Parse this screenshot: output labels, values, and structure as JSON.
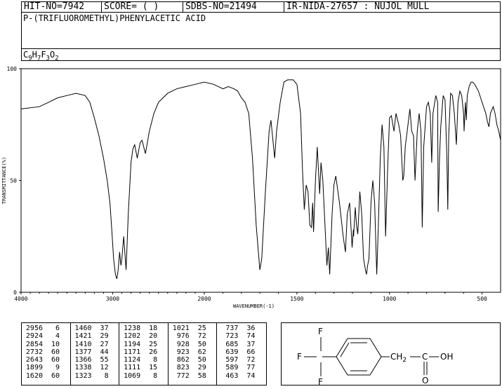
{
  "header": {
    "hit_no": "HIT-NO=7942",
    "score": "SCORE=  (   )",
    "sdbs_no": "SDBS-NO=21494",
    "ir_info": "IR-NIDA-27657 : NUJOL MULL"
  },
  "compound_name": "P-(TRIFLUOROMETHYL)PHENYLACETIC ACID",
  "formula": {
    "c": "C",
    "c_n": "9",
    "h": "H",
    "h_n": "7",
    "f": "F",
    "f_n": "3",
    "o": "O",
    "o_n": "2"
  },
  "chart_data": {
    "type": "line",
    "title": "",
    "xlabel": "WAVENUMBER(-1)",
    "ylabel": "TRANSMITTANCE(%)",
    "xlim": [
      4000,
      400
    ],
    "ylim": [
      0,
      100
    ],
    "x_ticks": [
      "4000",
      "3000",
      "2000",
      "1500",
      "1000",
      "500"
    ],
    "y_ticks": [
      "100",
      "50",
      "0"
    ],
    "grid": false,
    "series": [
      {
        "points": [
          [
            4000,
            82
          ],
          [
            3800,
            83
          ],
          [
            3700,
            85
          ],
          [
            3600,
            87
          ],
          [
            3500,
            88
          ],
          [
            3400,
            89
          ],
          [
            3300,
            88
          ],
          [
            3250,
            85
          ],
          [
            3200,
            78
          ],
          [
            3150,
            70
          ],
          [
            3100,
            60
          ],
          [
            3060,
            50
          ],
          [
            3030,
            40
          ],
          [
            3010,
            28
          ],
          [
            2990,
            15
          ],
          [
            2970,
            8
          ],
          [
            2955,
            6
          ],
          [
            2940,
            10
          ],
          [
            2924,
            18
          ],
          [
            2910,
            12
          ],
          [
            2900,
            15
          ],
          [
            2880,
            25
          ],
          [
            2854,
            10
          ],
          [
            2830,
            35
          ],
          [
            2800,
            58
          ],
          [
            2780,
            64
          ],
          [
            2760,
            66
          ],
          [
            2732,
            60
          ],
          [
            2700,
            67
          ],
          [
            2680,
            68
          ],
          [
            2643,
            62
          ],
          [
            2600,
            72
          ],
          [
            2550,
            80
          ],
          [
            2500,
            85
          ],
          [
            2400,
            89
          ],
          [
            2300,
            91
          ],
          [
            2200,
            92
          ],
          [
            2100,
            93
          ],
          [
            2000,
            94
          ],
          [
            1950,
            93
          ],
          [
            1899,
            91
          ],
          [
            1870,
            92
          ],
          [
            1840,
            91
          ],
          [
            1820,
            90
          ],
          [
            1800,
            87
          ],
          [
            1780,
            85
          ],
          [
            1760,
            80
          ],
          [
            1740,
            60
          ],
          [
            1720,
            30
          ],
          [
            1705,
            15
          ],
          [
            1700,
            10
          ],
          [
            1690,
            15
          ],
          [
            1670,
            45
          ],
          [
            1650,
            72
          ],
          [
            1640,
            77
          ],
          [
            1620,
            60
          ],
          [
            1610,
            72
          ],
          [
            1590,
            85
          ],
          [
            1570,
            94
          ],
          [
            1550,
            95
          ],
          [
            1520,
            95
          ],
          [
            1500,
            93
          ],
          [
            1480,
            80
          ],
          [
            1470,
            55
          ],
          [
            1460,
            37
          ],
          [
            1450,
            48
          ],
          [
            1440,
            45
          ],
          [
            1430,
            30
          ],
          [
            1421,
            29
          ],
          [
            1415,
            40
          ],
          [
            1410,
            27
          ],
          [
            1400,
            50
          ],
          [
            1390,
            65
          ],
          [
            1385,
            57
          ],
          [
            1377,
            44
          ],
          [
            1370,
            58
          ],
          [
            1366,
            55
          ],
          [
            1360,
            50
          ],
          [
            1338,
            12
          ],
          [
            1330,
            20
          ],
          [
            1323,
            8
          ],
          [
            1310,
            35
          ],
          [
            1300,
            48
          ],
          [
            1290,
            52
          ],
          [
            1270,
            40
          ],
          [
            1250,
            25
          ],
          [
            1238,
            18
          ],
          [
            1228,
            35
          ],
          [
            1215,
            40
          ],
          [
            1202,
            20
          ],
          [
            1195,
            28
          ],
          [
            1194,
            25
          ],
          [
            1185,
            38
          ],
          [
            1178,
            30
          ],
          [
            1171,
            26
          ],
          [
            1160,
            45
          ],
          [
            1150,
            35
          ],
          [
            1140,
            15
          ],
          [
            1130,
            10
          ],
          [
            1124,
            8
          ],
          [
            1118,
            12
          ],
          [
            1111,
            15
          ],
          [
            1100,
            40
          ],
          [
            1090,
            50
          ],
          [
            1080,
            40
          ],
          [
            1069,
            8
          ],
          [
            1060,
            30
          ],
          [
            1050,
            60
          ],
          [
            1040,
            75
          ],
          [
            1030,
            65
          ],
          [
            1021,
            25
          ],
          [
            1010,
            55
          ],
          [
            1000,
            78
          ],
          [
            990,
            79
          ],
          [
            976,
            72
          ],
          [
            965,
            80
          ],
          [
            950,
            75
          ],
          [
            940,
            70
          ],
          [
            928,
            50
          ],
          [
            923,
            52
          ],
          [
            915,
            65
          ],
          [
            900,
            75
          ],
          [
            890,
            82
          ],
          [
            880,
            72
          ],
          [
            870,
            70
          ],
          [
            862,
            50
          ],
          [
            850,
            72
          ],
          [
            840,
            80
          ],
          [
            830,
            72
          ],
          [
            823,
            29
          ],
          [
            815,
            65
          ],
          [
            800,
            83
          ],
          [
            790,
            85
          ],
          [
            780,
            80
          ],
          [
            772,
            58
          ],
          [
            765,
            80
          ],
          [
            750,
            88
          ],
          [
            740,
            85
          ],
          [
            737,
            36
          ],
          [
            730,
            60
          ],
          [
            723,
            74
          ],
          [
            710,
            88
          ],
          [
            700,
            86
          ],
          [
            690,
            60
          ],
          [
            685,
            37
          ],
          [
            680,
            70
          ],
          [
            670,
            89
          ],
          [
            660,
            88
          ],
          [
            650,
            80
          ],
          [
            639,
            66
          ],
          [
            630,
            85
          ],
          [
            620,
            90
          ],
          [
            610,
            88
          ],
          [
            600,
            80
          ],
          [
            597,
            72
          ],
          [
            590,
            85
          ],
          [
            585,
            77
          ],
          [
            580,
            88
          ],
          [
            570,
            92
          ],
          [
            560,
            94
          ],
          [
            550,
            94
          ],
          [
            540,
            93
          ],
          [
            520,
            90
          ],
          [
            500,
            85
          ],
          [
            480,
            80
          ],
          [
            470,
            76
          ],
          [
            463,
            74
          ],
          [
            455,
            80
          ],
          [
            440,
            83
          ],
          [
            430,
            80
          ],
          [
            420,
            75
          ],
          [
            410,
            72
          ],
          [
            400,
            68
          ]
        ]
      }
    ]
  },
  "peak_table": {
    "columns": [
      [
        [
          "2956",
          "6"
        ],
        [
          "2924",
          "4"
        ],
        [
          "2854",
          "10"
        ],
        [
          "2732",
          "60"
        ],
        [
          "2643",
          "60"
        ],
        [
          "1899",
          "9"
        ],
        [
          "1620",
          "60"
        ]
      ],
      [
        [
          "1460",
          "37"
        ],
        [
          "1421",
          "29"
        ],
        [
          "1410",
          "27"
        ],
        [
          "1377",
          "44"
        ],
        [
          "1366",
          "55"
        ],
        [
          "1338",
          "12"
        ],
        [
          "1323",
          "8"
        ]
      ],
      [
        [
          "1238",
          "18"
        ],
        [
          "1202",
          "20"
        ],
        [
          "1194",
          "25"
        ],
        [
          "1171",
          "26"
        ],
        [
          "1124",
          "8"
        ],
        [
          "1111",
          "15"
        ],
        [
          "1069",
          "8"
        ]
      ],
      [
        [
          "1021",
          "25"
        ],
        [
          "976",
          "72"
        ],
        [
          "928",
          "50"
        ],
        [
          "923",
          "62"
        ],
        [
          "862",
          "50"
        ],
        [
          "823",
          "29"
        ],
        [
          "772",
          "58"
        ]
      ],
      [
        [
          "737",
          "36"
        ],
        [
          "723",
          "74"
        ],
        [
          "685",
          "37"
        ],
        [
          "639",
          "66"
        ],
        [
          "597",
          "72"
        ],
        [
          "589",
          "77"
        ],
        [
          "463",
          "74"
        ]
      ]
    ]
  },
  "structure": {
    "f_top": "F",
    "f_left": "F",
    "f_bottom": "F",
    "c_label": "C",
    "ch2": "CH",
    "ch2_sub": "2",
    "carbonyl_c": "C",
    "oh": "OH",
    "o": "O"
  }
}
